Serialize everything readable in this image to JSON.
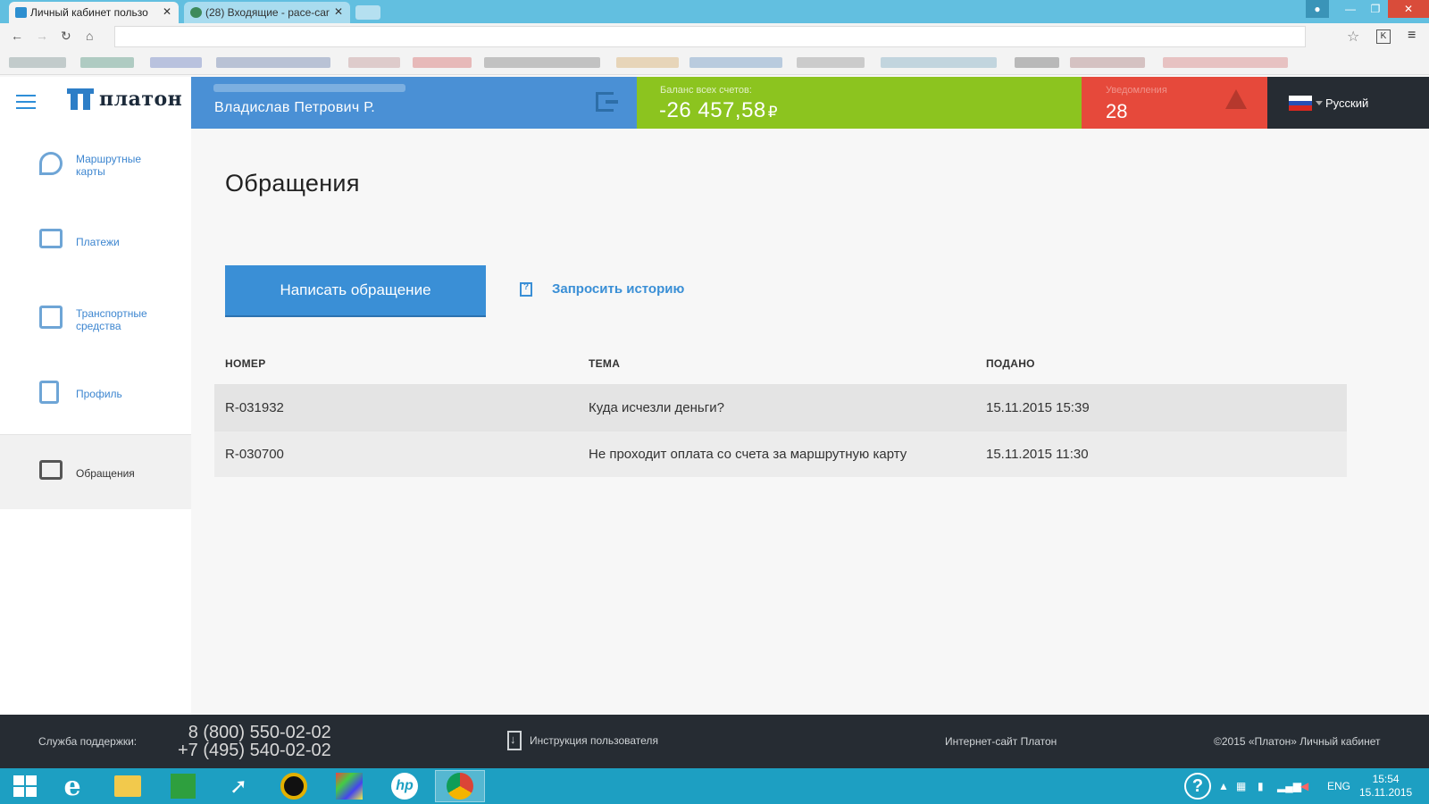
{
  "browser": {
    "tabs": [
      {
        "label": "Личный кабинет пользо",
        "active": true
      },
      {
        "label": "(28) Входящие - pace-car",
        "active": false
      }
    ],
    "tab_close": "✕"
  },
  "app": {
    "logo_text": "платон",
    "user": {
      "name": "Владислав Петрович Р."
    },
    "balance": {
      "label": "Баланс всех счетов:",
      "value": "-26 457,58",
      "currency": "₽"
    },
    "notifications": {
      "label": "Уведомления",
      "count": "28"
    },
    "language": {
      "label": "Русский"
    }
  },
  "sidebar": {
    "items": [
      {
        "label": "Маршрутные карты",
        "icon": "map-pin-icon",
        "active": false
      },
      {
        "label": "Платежи",
        "icon": "wallet-icon",
        "active": false
      },
      {
        "label": "Транспортные средства",
        "icon": "truck-icon",
        "active": false
      },
      {
        "label": "Профиль",
        "icon": "profile-icon",
        "active": false
      },
      {
        "label": "Обращения",
        "icon": "message-icon",
        "active": true
      }
    ]
  },
  "main": {
    "title": "Обращения",
    "write_button": "Написать обращение",
    "history_link": "Запросить историю",
    "table": {
      "headers": [
        "НОМЕР",
        "ТЕМА",
        "ПОДАНО"
      ],
      "rows": [
        [
          "R-031932",
          "Куда исчезли деньги?",
          "15.11.2015 15:39"
        ],
        [
          "R-030700",
          "Не проходит оплата со счета за маршрутную карту",
          "15.11.2015 11:30"
        ]
      ]
    }
  },
  "footer": {
    "support_label": "Служба поддержки:",
    "phone1": "8 (800) 550-02-02",
    "phone2": "+7 (495) 540-02-02",
    "manual": "Инструкция пользователя",
    "site": "Интернет-сайт Платон",
    "copyright": "©2015 «Платон» Личный кабинет"
  },
  "taskbar": {
    "lang": "ENG",
    "time": "15:54",
    "date": "15.11.2015"
  },
  "colors": {
    "accent_blue": "#3a8fd6",
    "balance_green": "#8cc41f",
    "notif_red": "#e6493b",
    "dark": "#262c33",
    "taskbar": "#1d9fc2"
  }
}
